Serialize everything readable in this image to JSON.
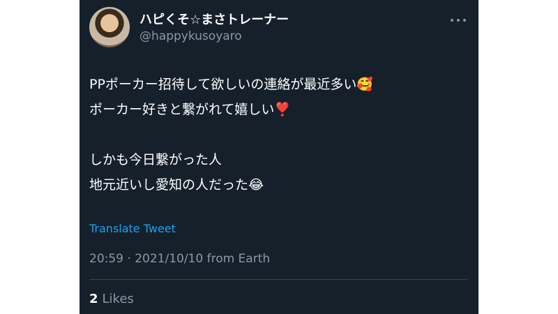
{
  "author": {
    "display_name": "ハピくそ☆まさトレーナー",
    "handle": "@happykusoyaro"
  },
  "tweet": {
    "lines": [
      "PPポーカー招待して欲しいの連絡が最近多い🥰",
      "ポーカー好きと繋がれて嬉しい❣️",
      "",
      "しかも今日繋がった人",
      "地元近いし愛知の人だった😂"
    ],
    "translate_label": "Translate Tweet",
    "timestamp": "20:59 · 2021/10/10 from Earth",
    "likes_count": "2",
    "likes_label": "Likes"
  },
  "icons": {
    "more": "more-horizontal-icon",
    "avatar": "profile-avatar"
  },
  "colors": {
    "background": "#15202b",
    "text": "#ffffff",
    "secondary_text": "#8899a6",
    "link": "#1da1f2",
    "divider": "#38444d"
  }
}
